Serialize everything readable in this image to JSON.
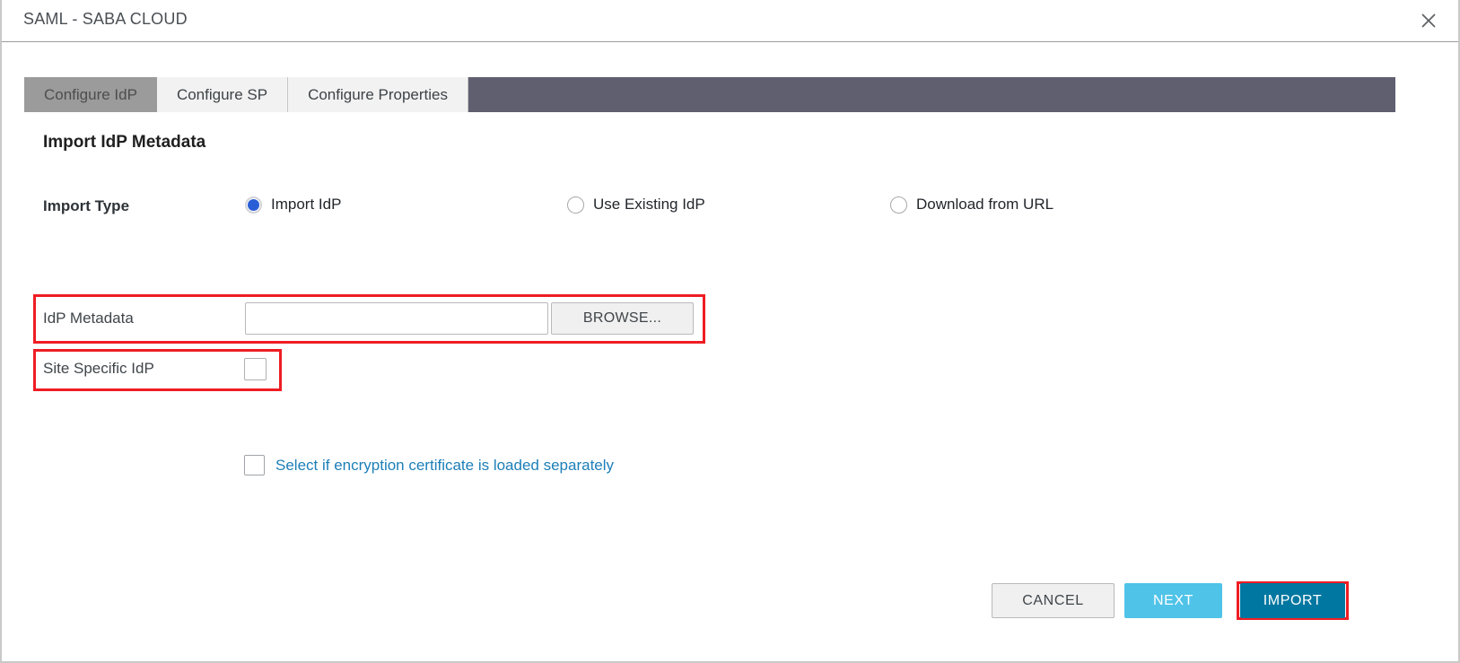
{
  "window": {
    "title": "SAML - SABA CLOUD",
    "close_icon": "close-icon"
  },
  "tabs": [
    {
      "label": "Configure IdP",
      "active": true
    },
    {
      "label": "Configure SP",
      "active": false
    },
    {
      "label": "Configure Properties",
      "active": false
    }
  ],
  "main": {
    "section_title": "Import IdP Metadata",
    "import_type": {
      "label": "Import Type",
      "options": [
        {
          "label": "Import IdP",
          "selected": true
        },
        {
          "label": "Use Existing IdP",
          "selected": false
        },
        {
          "label": "Download from URL",
          "selected": false
        }
      ]
    },
    "metadata": {
      "label": "IdP Metadata",
      "input_value": "",
      "input_placeholder": "",
      "browse_label": "BROWSE..."
    },
    "site_specific": {
      "label": "Site Specific IdP",
      "checked": false
    },
    "encryption": {
      "label": "Select if encryption certificate is loaded separately",
      "checked": false
    }
  },
  "footer": {
    "cancel_label": "CANCEL",
    "next_label": "NEXT",
    "import_label": "IMPORT"
  },
  "colors": {
    "tabstrip_bar": "#5f5f70",
    "tab_active": "#9b9b9b",
    "tab_inactive": "#f2f2f2",
    "radio_selected": "#2a5ed6",
    "link_blue": "#1c7fb8",
    "next_button": "#4fc3e8",
    "import_button": "#0077a0",
    "annotation_red": "#ee1d23"
  }
}
